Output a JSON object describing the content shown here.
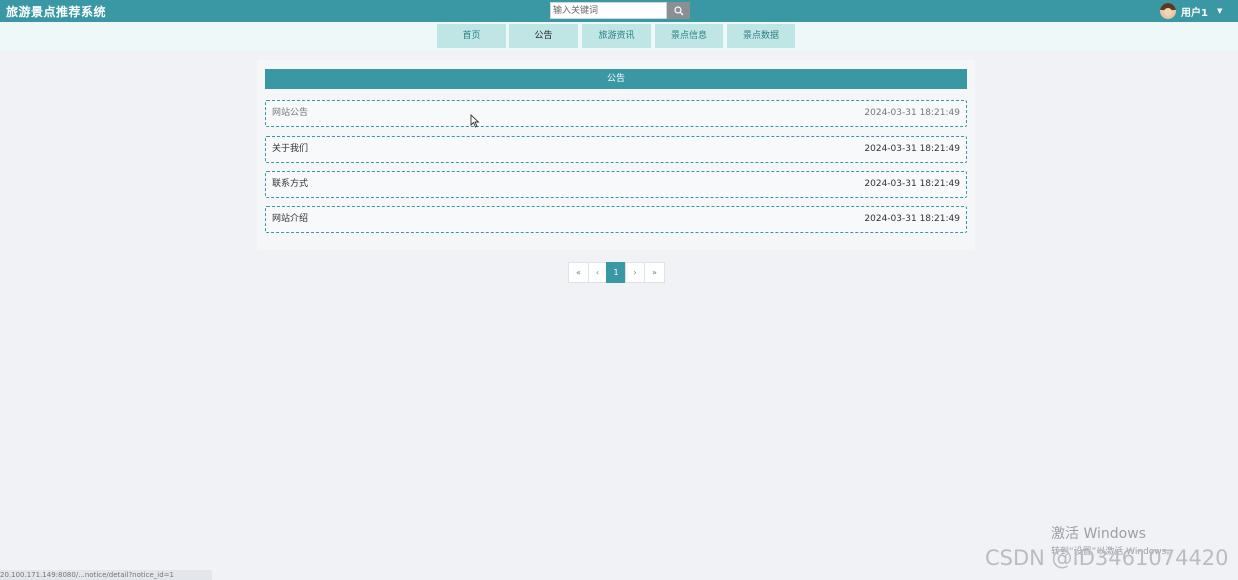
{
  "header": {
    "title": "旅游景点推荐系统",
    "search_placeholder": "输入关键词",
    "user_name": "用户1"
  },
  "nav": {
    "items": [
      {
        "label": "首页"
      },
      {
        "label": "公告"
      },
      {
        "label": "旅游资讯"
      },
      {
        "label": "景点信息"
      },
      {
        "label": "景点数据"
      }
    ],
    "active": "公告"
  },
  "notice_panel": {
    "header": "公告",
    "items": [
      {
        "title": "网站公告",
        "time": "2024-03-31 18:21:49"
      },
      {
        "title": "关于我们",
        "time": "2024-03-31 18:21:49"
      },
      {
        "title": "联系方式",
        "time": "2024-03-31 18:21:49"
      },
      {
        "title": "网站介绍",
        "time": "2024-03-31 18:21:49"
      }
    ]
  },
  "pagination": {
    "first": "«",
    "prev": "‹",
    "current": "1",
    "next": "›",
    "last": "»"
  },
  "overlay": {
    "activate_title": "激活 Windows",
    "activate_sub": "转到“设置”以激活 Windows。",
    "watermark": "CSDN @ID3461074420",
    "status_url": "20.100.171.149:8080/...notice/detail?notice_id=1"
  },
  "colors": {
    "primary": "#3a98a4",
    "nav_item_bg": "#bfe6e5",
    "page_bg": "#f1f2f6"
  }
}
